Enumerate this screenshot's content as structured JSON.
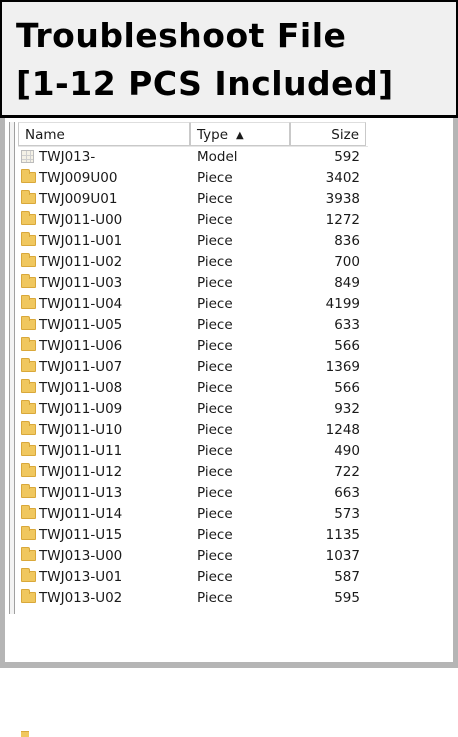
{
  "banner": {
    "line1": "Troubleshoot File",
    "line2": "[1-12 PCS Included]"
  },
  "columns": {
    "name": "Name",
    "type": "Type",
    "size": "Size",
    "sort_indicator": "▲"
  },
  "files": [
    {
      "name": "TWJ013-",
      "type": "Model",
      "size": "592",
      "icon": "model-icon"
    },
    {
      "name": "TWJ009U00",
      "type": "Piece",
      "size": "3402",
      "icon": "folder-icon"
    },
    {
      "name": "TWJ009U01",
      "type": "Piece",
      "size": "3938",
      "icon": "folder-icon"
    },
    {
      "name": "TWJ011-U00",
      "type": "Piece",
      "size": "1272",
      "icon": "folder-icon"
    },
    {
      "name": "TWJ011-U01",
      "type": "Piece",
      "size": "836",
      "icon": "folder-icon"
    },
    {
      "name": "TWJ011-U02",
      "type": "Piece",
      "size": "700",
      "icon": "folder-icon"
    },
    {
      "name": "TWJ011-U03",
      "type": "Piece",
      "size": "849",
      "icon": "folder-icon"
    },
    {
      "name": "TWJ011-U04",
      "type": "Piece",
      "size": "4199",
      "icon": "folder-icon"
    },
    {
      "name": "TWJ011-U05",
      "type": "Piece",
      "size": "633",
      "icon": "folder-icon"
    },
    {
      "name": "TWJ011-U06",
      "type": "Piece",
      "size": "566",
      "icon": "folder-icon"
    },
    {
      "name": "TWJ011-U07",
      "type": "Piece",
      "size": "1369",
      "icon": "folder-icon"
    },
    {
      "name": "TWJ011-U08",
      "type": "Piece",
      "size": "566",
      "icon": "folder-icon"
    },
    {
      "name": "TWJ011-U09",
      "type": "Piece",
      "size": "932",
      "icon": "folder-icon"
    },
    {
      "name": "TWJ011-U10",
      "type": "Piece",
      "size": "1248",
      "icon": "folder-icon"
    },
    {
      "name": "TWJ011-U11",
      "type": "Piece",
      "size": "490",
      "icon": "folder-icon"
    },
    {
      "name": "TWJ011-U12",
      "type": "Piece",
      "size": "722",
      "icon": "folder-icon"
    },
    {
      "name": "TWJ011-U13",
      "type": "Piece",
      "size": "663",
      "icon": "folder-icon"
    },
    {
      "name": "TWJ011-U14",
      "type": "Piece",
      "size": "573",
      "icon": "folder-icon"
    },
    {
      "name": "TWJ011-U15",
      "type": "Piece",
      "size": "1135",
      "icon": "folder-icon"
    },
    {
      "name": "TWJ013-U00",
      "type": "Piece",
      "size": "1037",
      "icon": "folder-icon"
    },
    {
      "name": "TWJ013-U01",
      "type": "Piece",
      "size": "587",
      "icon": "folder-icon"
    },
    {
      "name": "TWJ013-U02",
      "type": "Piece",
      "size": "595",
      "icon": "folder-icon"
    }
  ],
  "colors": {
    "banner_bg": "#f0f0f0",
    "folder": "#f0c75e",
    "frame": "#b5b5b5"
  }
}
